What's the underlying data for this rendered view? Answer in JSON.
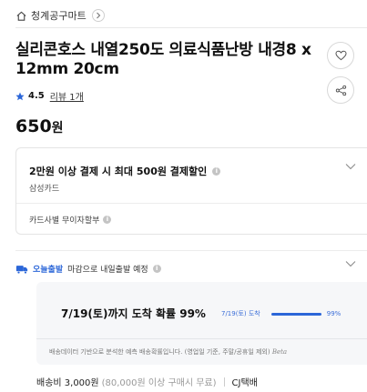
{
  "store": {
    "name": "청계공구마트",
    "home_icon": "home-icon",
    "chevron_icon": "chevron-right-icon"
  },
  "product": {
    "title": "실리콘호스 내열250도 의료식품난방 내경8 x 12mm 20cm",
    "rating": "4.5",
    "reviews": "리뷰 1개",
    "price": "650",
    "price_unit": "원"
  },
  "actions": {
    "favorite_icon": "heart-icon",
    "share_icon": "share-icon"
  },
  "benefit": {
    "title": "2만원 이상 결제 시 최대 500원 결제할인",
    "card": "삼성카드",
    "installment": "카드사별 무이자할부"
  },
  "delivery": {
    "today_label": "오늘출발",
    "desc": "마감으로 내일출발 예정",
    "arrival_title": "7/19(토)까지 도착 확률 99%",
    "arrival_mini_label": "7/19(토) 도착",
    "arrival_mini_percent": "99%",
    "arrival_probability": 0.99,
    "note": "배송데이터 기반으로 분석한 예측 배송확률입니다. (영업일 기준, 주말/공휴일 제외)",
    "beta": "Beta",
    "fee": "배송비 3,000원",
    "fee_condition": "(80,000원 이상 구매시 무료)",
    "courier": "CJ택배"
  },
  "colors": {
    "accent": "#2b66d8",
    "star": "#2b66d8"
  }
}
